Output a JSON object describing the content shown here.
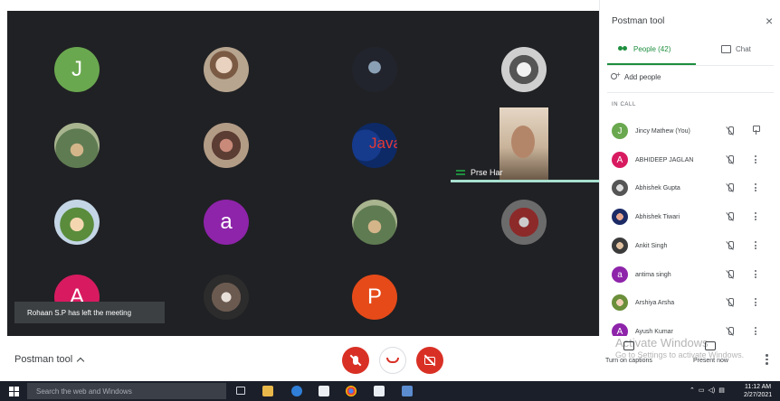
{
  "meeting": {
    "name": "Postman tool",
    "toast": "Rohaan S.P has left the meeting",
    "pinned_label": "Prse Har"
  },
  "grid": {
    "tiles": [
      {
        "kind": "letter",
        "letter": "J",
        "color": "#6aa84f"
      },
      {
        "kind": "photo",
        "style": "photo"
      },
      {
        "kind": "photo",
        "style": "photo3"
      },
      {
        "kind": "photo",
        "style": "photo4"
      },
      {
        "kind": "photo",
        "style": "photo8"
      },
      {
        "kind": "photo",
        "style": "photo5"
      },
      {
        "kind": "java",
        "text": "Java"
      },
      {
        "kind": "photo",
        "style": "photo6"
      },
      {
        "kind": "photo",
        "style": "photo7"
      },
      {
        "kind": "letter",
        "letter": "a",
        "color": "#8e24aa"
      },
      {
        "kind": "photo",
        "style": "photo8"
      },
      {
        "kind": "photo",
        "style": "photo9"
      },
      {
        "kind": "letter",
        "letter": "A",
        "color": "#d81b60"
      },
      {
        "kind": "photo",
        "style": "photo10"
      },
      {
        "kind": "letter",
        "letter": "P",
        "color": "#e64a19"
      }
    ]
  },
  "controls": {
    "captions_label": "Turn on captions",
    "present_label": "Present now",
    "mic_icon": "mic-off-icon",
    "hangup_icon": "call-end-icon",
    "camera_icon": "videocam-off-icon"
  },
  "watermark": {
    "line1": "Activate Windows",
    "line2": "Go to Settings to activate Windows."
  },
  "panel": {
    "title": "Postman tool",
    "tab_people": "People (42)",
    "tab_chat": "Chat",
    "add_people": "Add people",
    "in_call": "IN CALL",
    "people": [
      {
        "name": "Jincy Mathew (You)",
        "avatar": "letter",
        "letter": "J",
        "color": "#6aa84f",
        "action": "pin"
      },
      {
        "name": "ABHIDEEP JAGLAN",
        "avatar": "letter",
        "letter": "A",
        "color": "#d81b60",
        "action": "more"
      },
      {
        "name": "Abhishek Gupta",
        "avatar": "photo",
        "style": "ph1",
        "action": "more"
      },
      {
        "name": "Abhishek Tiwari",
        "avatar": "photo",
        "style": "ph2",
        "action": "more"
      },
      {
        "name": "Ankit Singh",
        "avatar": "photo",
        "style": "ph3",
        "action": "more"
      },
      {
        "name": "antima singh",
        "avatar": "letter",
        "letter": "a",
        "color": "#8e24aa",
        "action": "more"
      },
      {
        "name": "Arshiya Arsha",
        "avatar": "photo",
        "style": "ph4",
        "action": "more"
      },
      {
        "name": "Ayush Kumar",
        "avatar": "letter",
        "letter": "A",
        "color": "#8e24aa",
        "action": "more"
      }
    ]
  },
  "taskbar": {
    "search_placeholder": "Search the web and Windows",
    "time": "11:12 AM",
    "date": "2/27/2021"
  }
}
